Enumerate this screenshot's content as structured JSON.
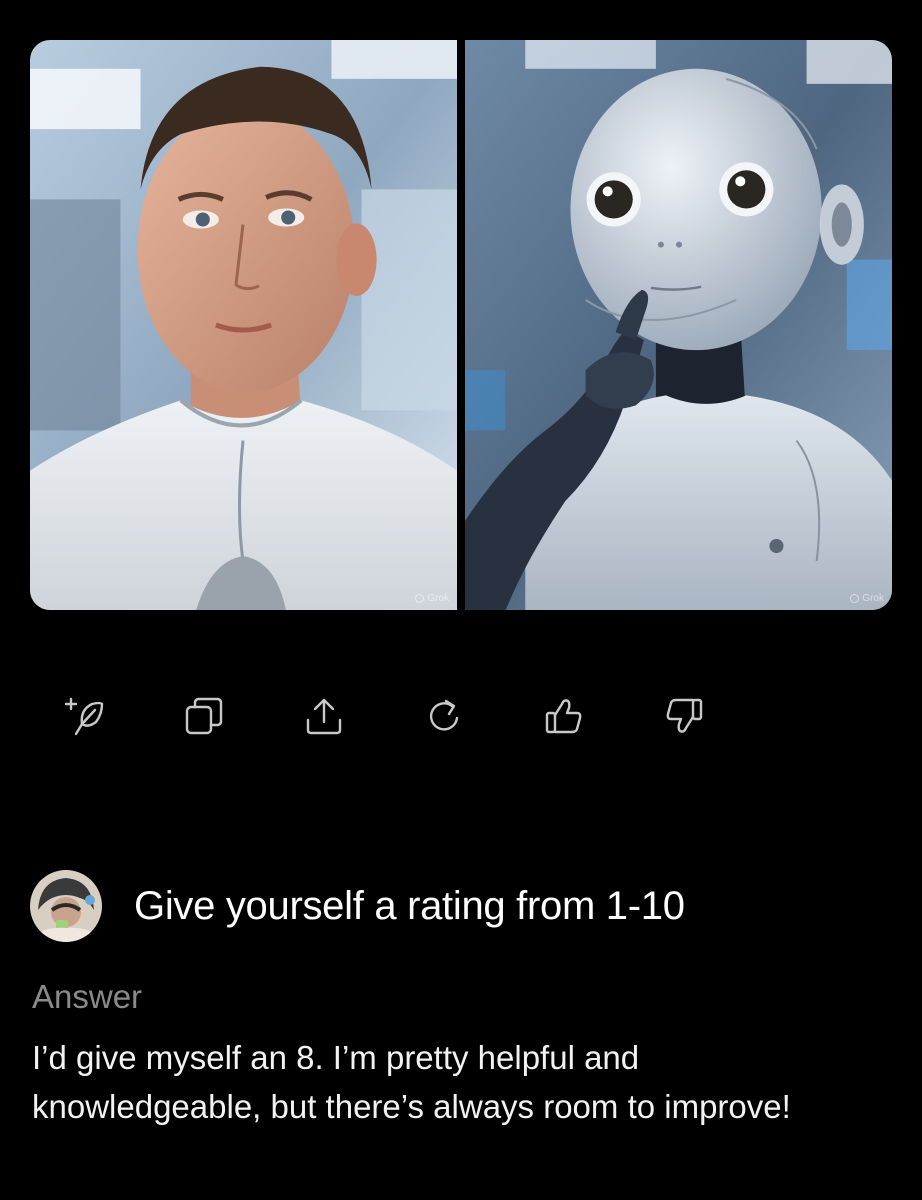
{
  "images": [
    {
      "name": "human-portrait",
      "watermark": "Grok"
    },
    {
      "name": "robot-portrait",
      "watermark": "Grok"
    }
  ],
  "actions": [
    {
      "name": "new-chat-button",
      "icon": "feather-plus-icon"
    },
    {
      "name": "copy-button",
      "icon": "copy-icon"
    },
    {
      "name": "share-button",
      "icon": "share-icon"
    },
    {
      "name": "regenerate-button",
      "icon": "refresh-icon"
    },
    {
      "name": "like-button",
      "icon": "thumbs-up-icon"
    },
    {
      "name": "dislike-button",
      "icon": "thumbs-down-icon"
    }
  ],
  "question": {
    "text": "Give yourself a rating from 1-10"
  },
  "answer": {
    "label": "Answer",
    "text": "I’d give myself an 8. I’m pretty helpful and knowledgeable, but there’s always room to improve!"
  },
  "colors": {
    "background": "#000000",
    "icon": "#c9c9c9",
    "answer_label": "#8a8a8a"
  }
}
